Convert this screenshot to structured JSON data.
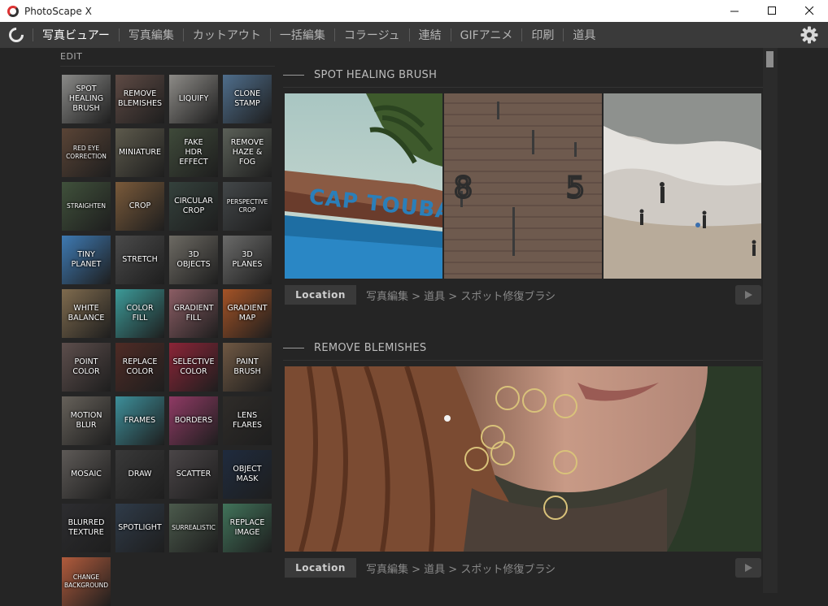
{
  "window": {
    "title": "PhotoScape X",
    "minimize": "—",
    "maximize": "☐",
    "close": "✕"
  },
  "menu": {
    "items": [
      "写真ビュアー",
      "写真編集",
      "カットアウト",
      "一括編集",
      "コラージュ",
      "連結",
      "GIFアニメ",
      "印刷",
      "道具"
    ],
    "active_index": 0
  },
  "left_panel": {
    "heading": "EDIT",
    "tools": [
      {
        "label": "SPOT\nHEALING\nBRUSH",
        "bg": "#8a8a88"
      },
      {
        "label": "REMOVE\nBLEMISHES",
        "bg": "#5e4a44"
      },
      {
        "label": "LIQUIFY",
        "bg": "#8d8b87"
      },
      {
        "label": "CLONE\nSTAMP",
        "bg": "#4f6e8c"
      },
      {
        "label": "RED EYE\nCORRECTION",
        "bg": "#5a4436",
        "small": true
      },
      {
        "label": "MINIATURE",
        "bg": "#5d5a4c"
      },
      {
        "label": "FAKE\nHDR EFFECT",
        "bg": "#3f4a3a"
      },
      {
        "label": "REMOVE\nHAZE & FOG",
        "bg": "#5b6058"
      },
      {
        "label": "STRAIGHTEN",
        "bg": "#40513b",
        "small": true
      },
      {
        "label": "CROP",
        "bg": "#7a5a3a"
      },
      {
        "label": "CIRCULAR\nCROP",
        "bg": "#34413c"
      },
      {
        "label": "PERSPECTIVE\nCROP",
        "bg": "#434749",
        "small": true
      },
      {
        "label": "TINY\nPLANET",
        "bg": "#3e7ab3"
      },
      {
        "label": "STRETCH",
        "bg": "#4a4a4a"
      },
      {
        "label": "3D\nOBJECTS",
        "bg": "#6d6a63"
      },
      {
        "label": "3D\nPLANES",
        "bg": "#6a6a69"
      },
      {
        "label": "WHITE\nBALANCE",
        "bg": "#7f6b4e"
      },
      {
        "label": "COLOR\nFILL",
        "bg": "#3c9a98"
      },
      {
        "label": "GRADIENT\nFILL",
        "bg": "#8b5d64"
      },
      {
        "label": "GRADIENT\nMAP",
        "bg": "#a45326"
      },
      {
        "label": "POINT\nCOLOR",
        "bg": "#5d4e4c"
      },
      {
        "label": "REPLACE\nCOLOR",
        "bg": "#4f2b25"
      },
      {
        "label": "SELECTIVE\nCOLOR",
        "bg": "#8b2437"
      },
      {
        "label": "PAINT\nBRUSH",
        "bg": "#6f5843"
      },
      {
        "label": "MOTION\nBLUR",
        "bg": "#66615a"
      },
      {
        "label": "FRAMES",
        "bg": "#3d8f9a"
      },
      {
        "label": "BORDERS",
        "bg": "#8f3a64"
      },
      {
        "label": "LENS\nFLARES",
        "bg": "#2f2c29"
      },
      {
        "label": "MOSAIC",
        "bg": "#5e5a57"
      },
      {
        "label": "DRAW",
        "bg": "#393939"
      },
      {
        "label": "SCATTER",
        "bg": "#4a4547"
      },
      {
        "label": "OBJECT\nMASK",
        "bg": "#1f2b3e"
      },
      {
        "label": "BLURRED\nTEXTURE",
        "bg": "#2d2d30"
      },
      {
        "label": "SPOTLIGHT",
        "bg": "#2f3b49"
      },
      {
        "label": "SURREALISTIC",
        "bg": "#4b5a4c",
        "small": true
      },
      {
        "label": "REPLACE\nIMAGE",
        "bg": "#41735a"
      },
      {
        "label": "CHANGE\nBACKGROUND",
        "bg": "#b15b3c",
        "small": true
      }
    ]
  },
  "sections": [
    {
      "title": "SPOT HEALING BRUSH",
      "location_label": "Location",
      "path": "写真編集 > 道具 > スポット修復ブラシ"
    },
    {
      "title": "REMOVE BLEMISHES",
      "location_label": "Location",
      "path": "写真編集 > 道具 > スポット修復ブラシ"
    }
  ],
  "icons": {
    "settings": "gear-icon",
    "play": "play-icon",
    "app": "photoscape-logo-icon"
  }
}
